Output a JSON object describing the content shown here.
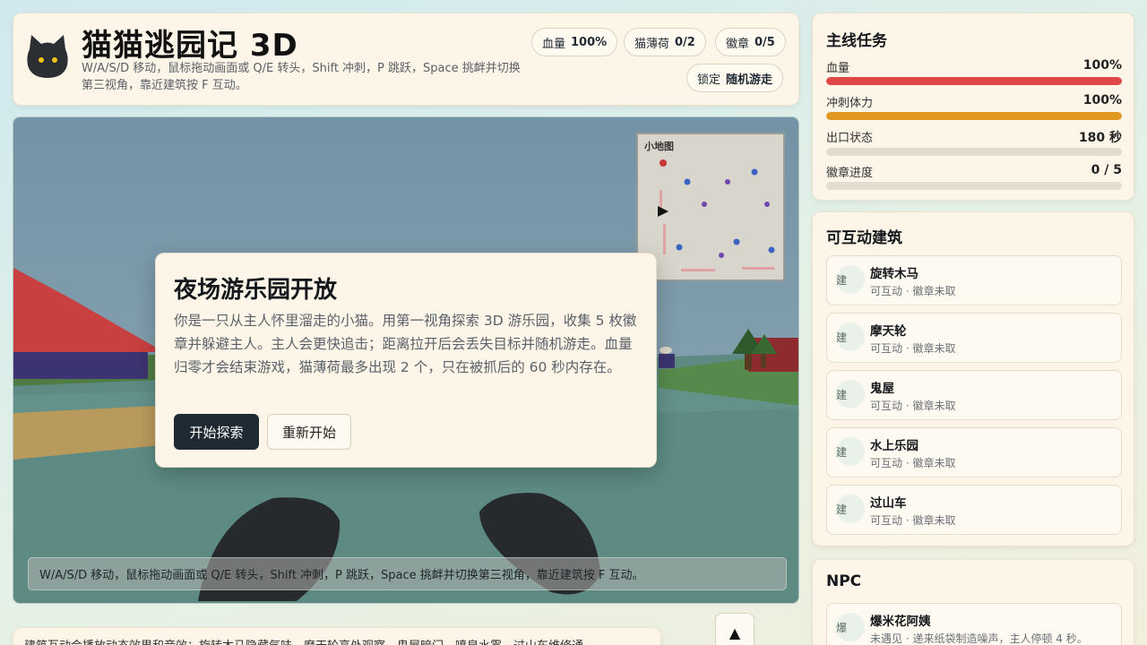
{
  "header": {
    "title": "猫猫逃园记 3D",
    "subtitle": "W/A/S/D 移动，鼠标拖动画面或 Q/E 转头，Shift 冲刺，P 跳跃，Space 挑衅并切换第三视角，靠近建筑按 F 互动。",
    "pills": {
      "hp_label": "血量",
      "hp_value": "100%",
      "mint_label": "猫薄荷",
      "mint_value": "0/2",
      "badge_label": "徽章",
      "badge_value": "0/5",
      "lock_label": "锁定",
      "lock_value": "随机游走"
    }
  },
  "game": {
    "minimap_label": "小地图",
    "hint": "W/A/S/D 移动，鼠标拖动画面或 Q/E 转头，Shift 冲刺，P 跳跃，Space 挑衅并切换第三视角，靠近建筑按 F 互动。"
  },
  "dialog": {
    "title": "夜场游乐园开放",
    "body": "你是一只从主人怀里溜走的小猫。用第一视角探索 3D 游乐园，收集 5 枚徽章并躲避主人。主人会更快追击；距离拉开后会丢失目标并随机游走。血量归零才会结束游戏，猫薄荷最多出现 2 个，只在被抓后的 60 秒内存在。",
    "start_label": "开始探索",
    "restart_label": "重新开始"
  },
  "bottom_note": "建筑互动会播放动态效果和音效：旋转木马隐藏气味，摩天轮高处观察，鬼屋暗门，喷泉水雾，过山车维修通",
  "up_button": "▲",
  "quest": {
    "title": "主线任务",
    "stats": [
      {
        "label": "血量",
        "value": "100%",
        "fill": 1.0,
        "color": "#e04848"
      },
      {
        "label": "冲刺体力",
        "value": "100%",
        "fill": 1.0,
        "color": "#e09a22"
      },
      {
        "label": "出口状态",
        "value": "180 秒",
        "fill": 0.0,
        "color": "#9aa0a6"
      },
      {
        "label": "徽章进度",
        "value": "0 / 5",
        "fill": 0.0,
        "color": "#9aa0a6"
      }
    ]
  },
  "buildings": {
    "title": "可互动建筑",
    "items": [
      {
        "icon": "建",
        "name": "旋转木马",
        "status": "可互动 · 徽章未取"
      },
      {
        "icon": "建",
        "name": "摩天轮",
        "status": "可互动 · 徽章未取"
      },
      {
        "icon": "建",
        "name": "鬼屋",
        "status": "可互动 · 徽章未取"
      },
      {
        "icon": "建",
        "name": "水上乐园",
        "status": "可互动 · 徽章未取"
      },
      {
        "icon": "建",
        "name": "过山车",
        "status": "可互动 · 徽章未取"
      }
    ]
  },
  "npc": {
    "title": "NPC",
    "items": [
      {
        "icon": "爆",
        "name": "爆米花阿姨",
        "status": "未遇见 · 递来纸袋制造噪声，主人停顿 4 秒。"
      }
    ]
  },
  "colors": {
    "sky": "#7898aa",
    "ground": "#5f8880",
    "panel_bg": "#fdf6e8",
    "dark_button": "#1f2a33",
    "hp_bar": "#e04848",
    "stamina_bar": "#e09a22"
  }
}
